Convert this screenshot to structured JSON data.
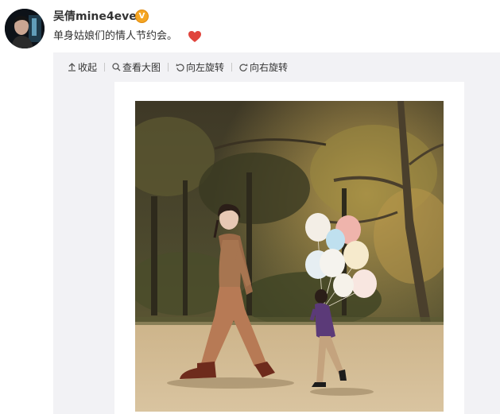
{
  "post": {
    "username": "吴倩mine4ever",
    "verified_badge": "V",
    "text": "单身姑娘们的情人节约会。",
    "emoji": "heart-icon"
  },
  "toolbar": {
    "collapse_label": "收起",
    "view_large_label": "查看大图",
    "rotate_left_label": "向左旋转",
    "rotate_right_label": "向右旋转"
  },
  "colors": {
    "accent": "#f5a623",
    "heart": "#e0443c",
    "panel_bg": "#f2f2f5"
  }
}
